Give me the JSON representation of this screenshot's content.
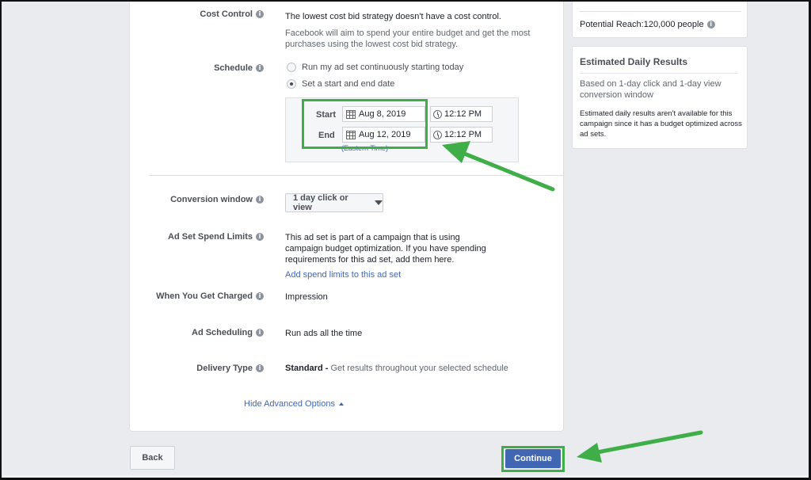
{
  "cost_control": {
    "label": "Cost Control",
    "line1": "The lowest cost bid strategy doesn't have a cost control.",
    "line2": "Facebook will aim to spend your entire budget and get the most purchases using the lowest cost bid strategy."
  },
  "schedule": {
    "label": "Schedule",
    "option_continuous": "Run my ad set continuously starting today",
    "option_dates": "Set a start and end date",
    "selected": "Set a start and end date",
    "start_label": "Start",
    "start_date": "Aug 8, 2019",
    "start_time": "12:12 PM",
    "end_label": "End",
    "end_date": "Aug 12, 2019",
    "end_time": "12:12 PM",
    "timezone_text": "(Eastern Time)"
  },
  "conversion_window": {
    "label": "Conversion window",
    "value": "1 day click or view"
  },
  "spend_limits": {
    "label": "Ad Set Spend Limits",
    "text": "This ad set is part of a campaign that is using campaign budget optimization. If you have spending requirements for this ad set, add them here.",
    "link": "Add spend limits to this ad set"
  },
  "charged": {
    "label": "When You Get Charged",
    "value": "Impression"
  },
  "ad_scheduling": {
    "label": "Ad Scheduling",
    "value": "Run ads all the time"
  },
  "delivery_type": {
    "label": "Delivery Type",
    "value_bold": "Standard -",
    "value_desc": "Get results throughout your selected schedule"
  },
  "hide_advanced": "Hide Advanced Options",
  "sidebar": {
    "potential_reach": "Potential Reach:120,000 people",
    "estimated_title": "Estimated Daily Results",
    "estimated_basis": "Based on 1-day click and 1-day view conversion window",
    "estimated_note": "Estimated daily results aren't available for this campaign since it has a budget optimized across ad sets."
  },
  "footer": {
    "back": "Back",
    "continue": "Continue"
  },
  "icons": {
    "info": "info-icon",
    "calendar": "calendar-icon",
    "clock": "clock-icon",
    "caret": "caret-down-icon"
  },
  "colors": {
    "highlight": "#3fae49",
    "primary": "#4267b2",
    "link": "#4267b2"
  }
}
